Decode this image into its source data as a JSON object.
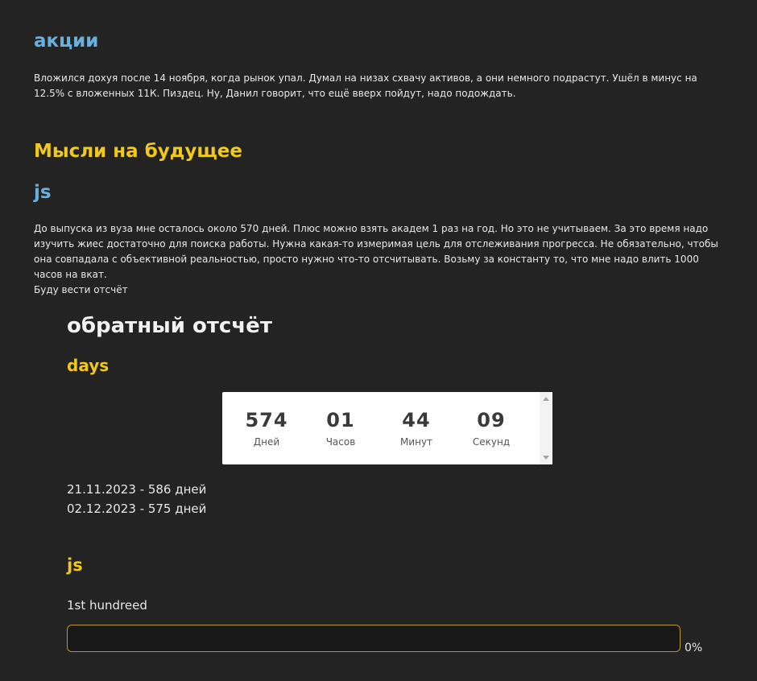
{
  "section_stocks": {
    "heading": "акции",
    "text": "Вложился дохуя после 14 ноября, когда рынок упал. Думал на низах схвачу активов, а они немного подрастут. Ушёл в минус на 12.5% с вложенных 11К. Пиздец. Ну, Данил говорит, что ещё вверх пойдут, надо подождать."
  },
  "section_future": {
    "heading": "Мысли на будущее",
    "sub_heading": "js",
    "text": "До выпуска из вуза мне осталось около 570 дней. Плюс можно взять академ 1 раз на год. Но это не учитываем. За это время надо изучить жиес достаточно для поиска работы. Нужна какая-то измеримая цель для отслеживания прогресса. Не обязательно, чтобы она совпадала с объективной реальностью, просто нужно что-то отсчитывать. Возьму за константу то, что мне надо влить 1000 часов на вкат.",
    "note": "Буду вести отсчёт"
  },
  "countdown": {
    "title": "обратный отсчёт",
    "subtitle": "days",
    "cells": [
      {
        "value": "574",
        "label": "Дней"
      },
      {
        "value": "01",
        "label": "Часов"
      },
      {
        "value": "44",
        "label": "Минут"
      },
      {
        "value": "09",
        "label": "Секунд"
      }
    ],
    "log": [
      "21.11.2023 - 586 дней",
      "02.12.2023 - 575 дней"
    ]
  },
  "progress": {
    "heading": "js",
    "label": "1st hundreed",
    "percent_text": "0%",
    "fraction": 0,
    "color": "#b8962a"
  },
  "colors": {
    "background": "#232323",
    "heading_blue": "#6ab0df",
    "heading_yellow": "#f0c91a"
  }
}
